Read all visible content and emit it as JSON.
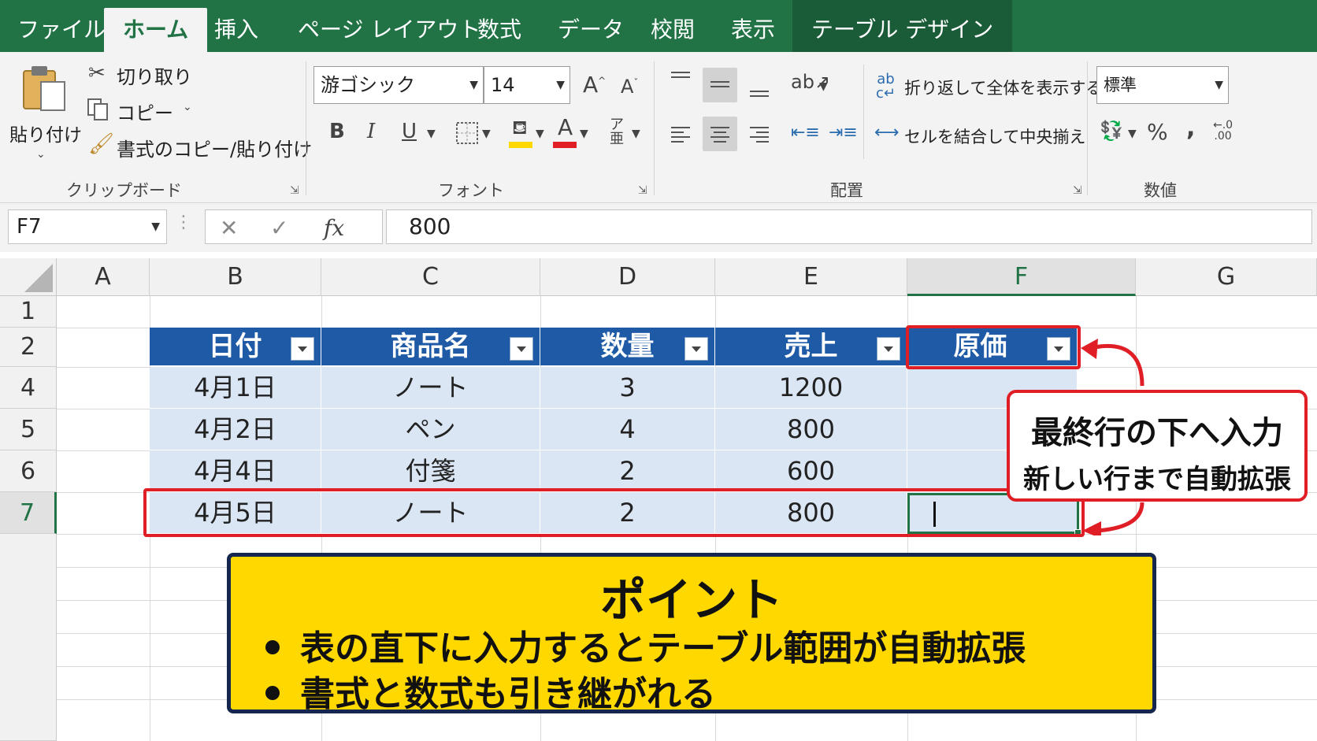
{
  "ribbon_tabs": [
    "ファイル",
    "ホーム",
    "挿入",
    "ページ レイアウト",
    "数式",
    "データ",
    "校閲",
    "表示",
    "テーブル デザイン"
  ],
  "clipboard": {
    "paste_label": "貼り付け",
    "cut_label": "切り取り",
    "copy_label": "コピー",
    "format_painter_label": "書式のコピー/貼り付け",
    "group_label": "クリップボード"
  },
  "font": {
    "font_name": "游ゴシック",
    "font_size": "14",
    "grow_label": "A",
    "shrink_label": "A",
    "bold_label": "B",
    "italic_label": "I",
    "underline_label": "U",
    "group_label": "フォント",
    "highlight_color": "#ffd800",
    "font_color": "#e01e26"
  },
  "alignment": {
    "wrap_label": "折り返して全体を表示する",
    "merge_label": "セルを結合して中央揃え",
    "group_label": "配置"
  },
  "number": {
    "format_value": "標準",
    "percent_label": "%",
    "comma_label": ",",
    "group_label": "数値"
  },
  "formula_bar": {
    "name_box": "F7",
    "fx_label": "fx",
    "value": "800"
  },
  "columns": [
    "A",
    "B",
    "C",
    "D",
    "E",
    "F",
    "G"
  ],
  "selected_column": "F",
  "rows": [
    "1",
    "2",
    "4",
    "5",
    "6",
    "7"
  ],
  "selected_row": "7",
  "table": {
    "headers": [
      "日付",
      "商品名",
      "数量",
      "売上",
      "原価"
    ],
    "data": [
      [
        "4月1日",
        "ノート",
        "3",
        "1200",
        ""
      ],
      [
        "4月2日",
        "ペン",
        "4",
        "800",
        ""
      ],
      [
        "4月4日",
        "付箋",
        "2",
        "600",
        ""
      ],
      [
        "4月5日",
        "ノート",
        "2",
        "800",
        ""
      ]
    ]
  },
  "callout": {
    "line1": "最終行の下へ入力",
    "line2": "新しい行まで自動拡張"
  },
  "point": {
    "title": "ポイント",
    "items": [
      "表の直下に入力するとテーブル範囲が自動拡張",
      "書式と数式も引き継がれる"
    ]
  },
  "colors": {
    "excel_green": "#217346",
    "table_header": "#1f5aa6",
    "table_band": "#dbe6f4",
    "highlight_red": "#e01e26",
    "point_yellow": "#ffd800",
    "point_border": "#16274f"
  }
}
